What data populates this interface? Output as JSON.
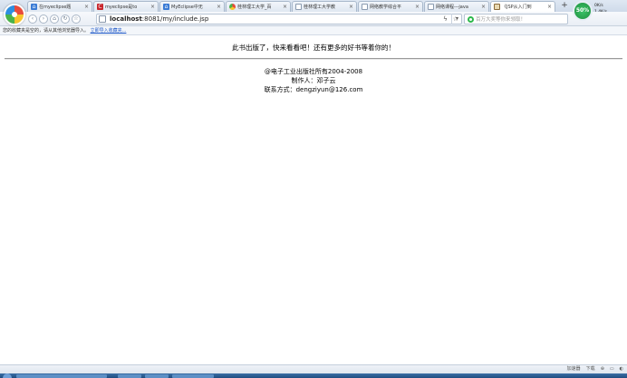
{
  "tabs": [
    {
      "label": "在myeclipse题",
      "icon": "house-icon",
      "active": false
    },
    {
      "label": "myeclipse是to",
      "icon": "red-c-icon",
      "active": false
    },
    {
      "label": "MyEclipse中无",
      "icon": "house-icon",
      "active": false
    },
    {
      "label": "桂林理工大学_百",
      "icon": "chrome-icon",
      "active": false
    },
    {
      "label": "桂林理工大学教",
      "icon": "page-icon",
      "active": false
    },
    {
      "label": "网络教学综合平",
      "icon": "page-icon",
      "active": false
    },
    {
      "label": "网络课程---java",
      "icon": "page-icon",
      "active": false
    },
    {
      "label": "《JSP从入门到",
      "icon": "image-icon",
      "active": true
    }
  ],
  "tab_close": "×",
  "new_tab": "+",
  "speed_badge": "50%",
  "net": {
    "up": "0K/s",
    "down": "1.4K/s"
  },
  "url": {
    "host": "localhost",
    "rest": ":8081/my/include.jsp"
  },
  "search_placeholder": "百万大奖等你来领取！",
  "favbar": {
    "text": "您的收藏夹是空的，请从其他浏览器导入。",
    "link": "立即导入收藏夹..."
  },
  "page": {
    "headline": "此书出版了，快来看看吧！还有更多的好书等着你的！",
    "copyright": "@电子工业出版社所有2004-2008",
    "author": "制作人：邓子云",
    "contact": "联系方式：dengziyun@126.com"
  },
  "status": {
    "accelerator": "加速器",
    "download": "下载"
  }
}
